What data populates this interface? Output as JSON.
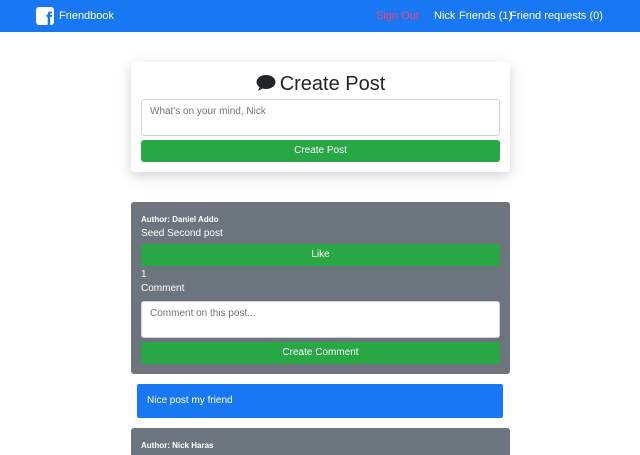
{
  "navbar": {
    "brand": "Friendbook",
    "sign_out": "Sign Out",
    "user": "Nick",
    "friends": "Friends (1)",
    "friend_requests": "Friend requests (0)"
  },
  "create_post": {
    "title": "Create Post",
    "placeholder": "What's on your mind, Nick",
    "button": "Create Post"
  },
  "posts": [
    {
      "author": "Author: Daniel Addo",
      "content": "Seed Second post",
      "like_button": "Like",
      "likes": "1",
      "comment_label": "Comment",
      "comment_placeholder": "Comment on this post...",
      "comment_button": "Create Comment",
      "comments": [
        "Nice post my friend"
      ]
    },
    {
      "author": "Author: Nick Haras"
    }
  ],
  "colors": {
    "navbar": "#1877f2",
    "sign_out": "#ff3d6e",
    "button": "#28a745",
    "post_card": "#6c757d",
    "comment": "#1877f2"
  }
}
